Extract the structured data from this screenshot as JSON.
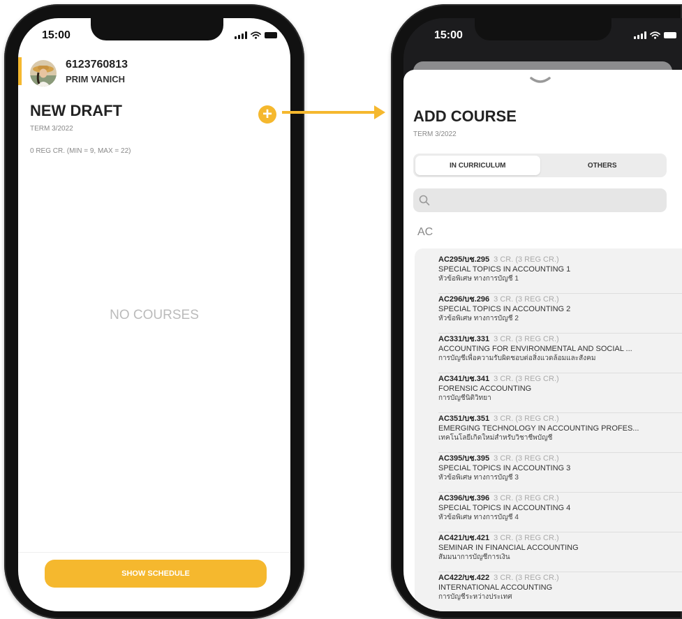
{
  "left_screen": {
    "status_time": "15:00",
    "student_id": "6123760813",
    "student_name": "PRIM VANICH",
    "draft_title": "NEW DRAFT",
    "term": "TERM 3/2022",
    "reg_summary": "0 REG CR. (MIN = 9, MAX = 22)",
    "empty_message": "NO COURSES",
    "add_button_label": "+",
    "show_schedule_label": "SHOW SCHEDULE"
  },
  "right_screen": {
    "status_time": "15:00",
    "title": "ADD COURSE",
    "term": "TERM 3/2022",
    "tabs": [
      {
        "label": "IN CURRICULUM",
        "active": true
      },
      {
        "label": "OTHERS",
        "active": false
      }
    ],
    "search_placeholder": "",
    "section": "AC",
    "courses": [
      {
        "code": "AC295/บช.295",
        "credits": "3 CR. (3 REG CR.)",
        "name_en": "SPECIAL TOPICS IN ACCOUNTING 1",
        "name_th": "หัวข้อพิเศษ ทางการบัญชี 1"
      },
      {
        "code": "AC296/บช.296",
        "credits": "3 CR. (3 REG CR.)",
        "name_en": "SPECIAL TOPICS IN ACCOUNTING 2",
        "name_th": "หัวข้อพิเศษ ทางการบัญชี 2"
      },
      {
        "code": "AC331/บช.331",
        "credits": "3 CR. (3 REG CR.)",
        "name_en": "ACCOUNTING FOR ENVIRONMENTAL AND SOCIAL ...",
        "name_th": "การบัญชีเพื่อความรับผิดชอบต่อสิ่งแวดล้อมและสังคม"
      },
      {
        "code": "AC341/บช.341",
        "credits": "3 CR. (3 REG CR.)",
        "name_en": "FORENSIC ACCOUNTING",
        "name_th": "การบัญชีนิติวิทยา"
      },
      {
        "code": "AC351/บช.351",
        "credits": "3 CR. (3 REG CR.)",
        "name_en": "EMERGING TECHNOLOGY IN ACCOUNTING PROFES...",
        "name_th": "เทคโนโลยีเกิดใหม่สำหรับวิชาชีพบัญชี"
      },
      {
        "code": "AC395/บช.395",
        "credits": "3 CR. (3 REG CR.)",
        "name_en": "SPECIAL TOPICS IN ACCOUNTING 3",
        "name_th": "หัวข้อพิเศษ ทางการบัญชี 3"
      },
      {
        "code": "AC396/บช.396",
        "credits": "3 CR. (3 REG CR.)",
        "name_en": "SPECIAL TOPICS IN ACCOUNTING 4",
        "name_th": "หัวข้อพิเศษ ทางการบัญชี 4"
      },
      {
        "code": "AC421/บช.421",
        "credits": "3 CR. (3 REG CR.)",
        "name_en": "SEMINAR IN FINANCIAL ACCOUNTING",
        "name_th": "สัมมนาการบัญชีการเงิน"
      },
      {
        "code": "AC422/บช.422",
        "credits": "3 CR. (3 REG CR.)",
        "name_en": "INTERNATIONAL ACCOUNTING",
        "name_th": "การบัญชีระหว่างประเทศ"
      }
    ]
  },
  "colors": {
    "accent": "#f5b82e",
    "phone_frame": "#111111",
    "muted_text": "#888888"
  },
  "icons": [
    "signal-icon",
    "wifi-icon",
    "battery-icon",
    "add-icon",
    "search-icon",
    "chevron-down-icon",
    "arrow-right-icon",
    "avatar"
  ]
}
